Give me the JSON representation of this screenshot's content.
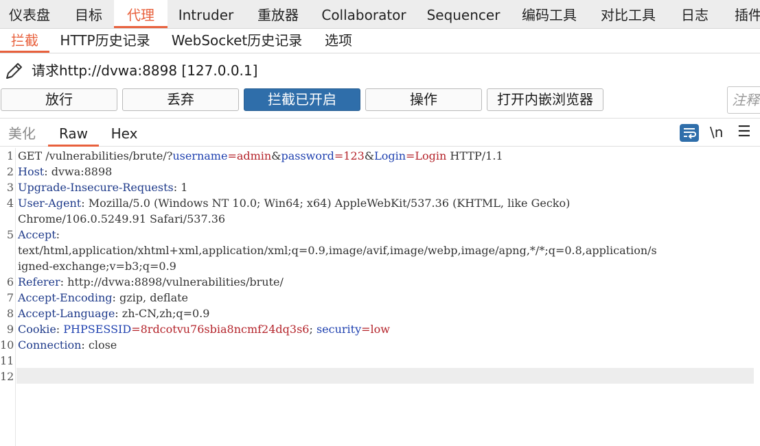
{
  "top_tabs": [
    {
      "label": "仪表盘"
    },
    {
      "label": "目标"
    },
    {
      "label": "代理"
    },
    {
      "label": "Intruder"
    },
    {
      "label": "重放器"
    },
    {
      "label": "Collaborator"
    },
    {
      "label": "Sequencer"
    },
    {
      "label": "编码工具"
    },
    {
      "label": "对比工具"
    },
    {
      "label": "日志"
    },
    {
      "label": "插件"
    }
  ],
  "sub_tabs": [
    {
      "label": "拦截"
    },
    {
      "label": "HTTP历史记录"
    },
    {
      "label": "WebSocket历史记录"
    },
    {
      "label": "选项"
    }
  ],
  "request": {
    "title": "请求http://dvwa:8898  [127.0.0.1]"
  },
  "buttons": {
    "forward": "放行",
    "drop": "丢弃",
    "intercept": "拦截已开启",
    "action": "操作",
    "open_browser": "打开内嵌浏览器"
  },
  "comment": {
    "placeholder": "注释"
  },
  "view_tabs": {
    "pretty": "美化",
    "raw": "Raw",
    "hex": "Hex"
  },
  "editor_tools": {
    "newline": "\\n",
    "menu": "☰"
  },
  "colors": {
    "accent": "#e8603c",
    "primary_button": "#2f6eaa",
    "header_name": "#1e3a8a",
    "param_value": "#b4232a"
  },
  "editor": {
    "line_numbers": [
      "1",
      "2",
      "3",
      "4",
      "5",
      "6",
      "7",
      "8",
      "9",
      "10",
      "11",
      "12"
    ],
    "l1": {
      "method": "GET /vulnerabilities/brute/?",
      "p1": "username",
      "eq1": "=",
      "v1": "admin",
      "amp1": "&",
      "p2": "password",
      "eq2": "=",
      "v2": "123",
      "amp2": "&",
      "p3": "Login",
      "eq3": "=",
      "v3": "Login",
      "proto": " HTTP/1.1"
    },
    "l2": {
      "name": "Host",
      "value": ": dvwa:8898"
    },
    "l3": {
      "name": "Upgrade-Insecure-Requests",
      "value": ": 1"
    },
    "l4": {
      "name": "User-Agent",
      "value": ": Mozilla/5.0 (Windows NT 10.0; Win64; x64) AppleWebKit/537.36 (KHTML, like Gecko)"
    },
    "l4b": "Chrome/106.0.5249.91 Safari/537.36",
    "l5": {
      "name": "Accept",
      "value": ":"
    },
    "l5b": "text/html,application/xhtml+xml,application/xml;q=0.9,image/avif,image/webp,image/apng,*/*;q=0.8,application/s",
    "l5c": "igned-exchange;v=b3;q=0.9",
    "l6": {
      "name": "Referer",
      "value": ": http://dvwa:8898/vulnerabilities/brute/"
    },
    "l7": {
      "name": "Accept-Encoding",
      "value": ": gzip, deflate"
    },
    "l8": {
      "name": "Accept-Language",
      "value": ": zh-CN,zh;q=0.9"
    },
    "l9": {
      "name": "Cookie",
      "sep": ": ",
      "c1": "PHPSESSID",
      "eq1": "=",
      "v1": "8rdcotvu76sbia8ncmf24dq3s6",
      "semi": "; ",
      "c2": "security",
      "eq2": "=",
      "v2": "low"
    },
    "l10": {
      "name": "Connection",
      "value": ": close"
    }
  }
}
